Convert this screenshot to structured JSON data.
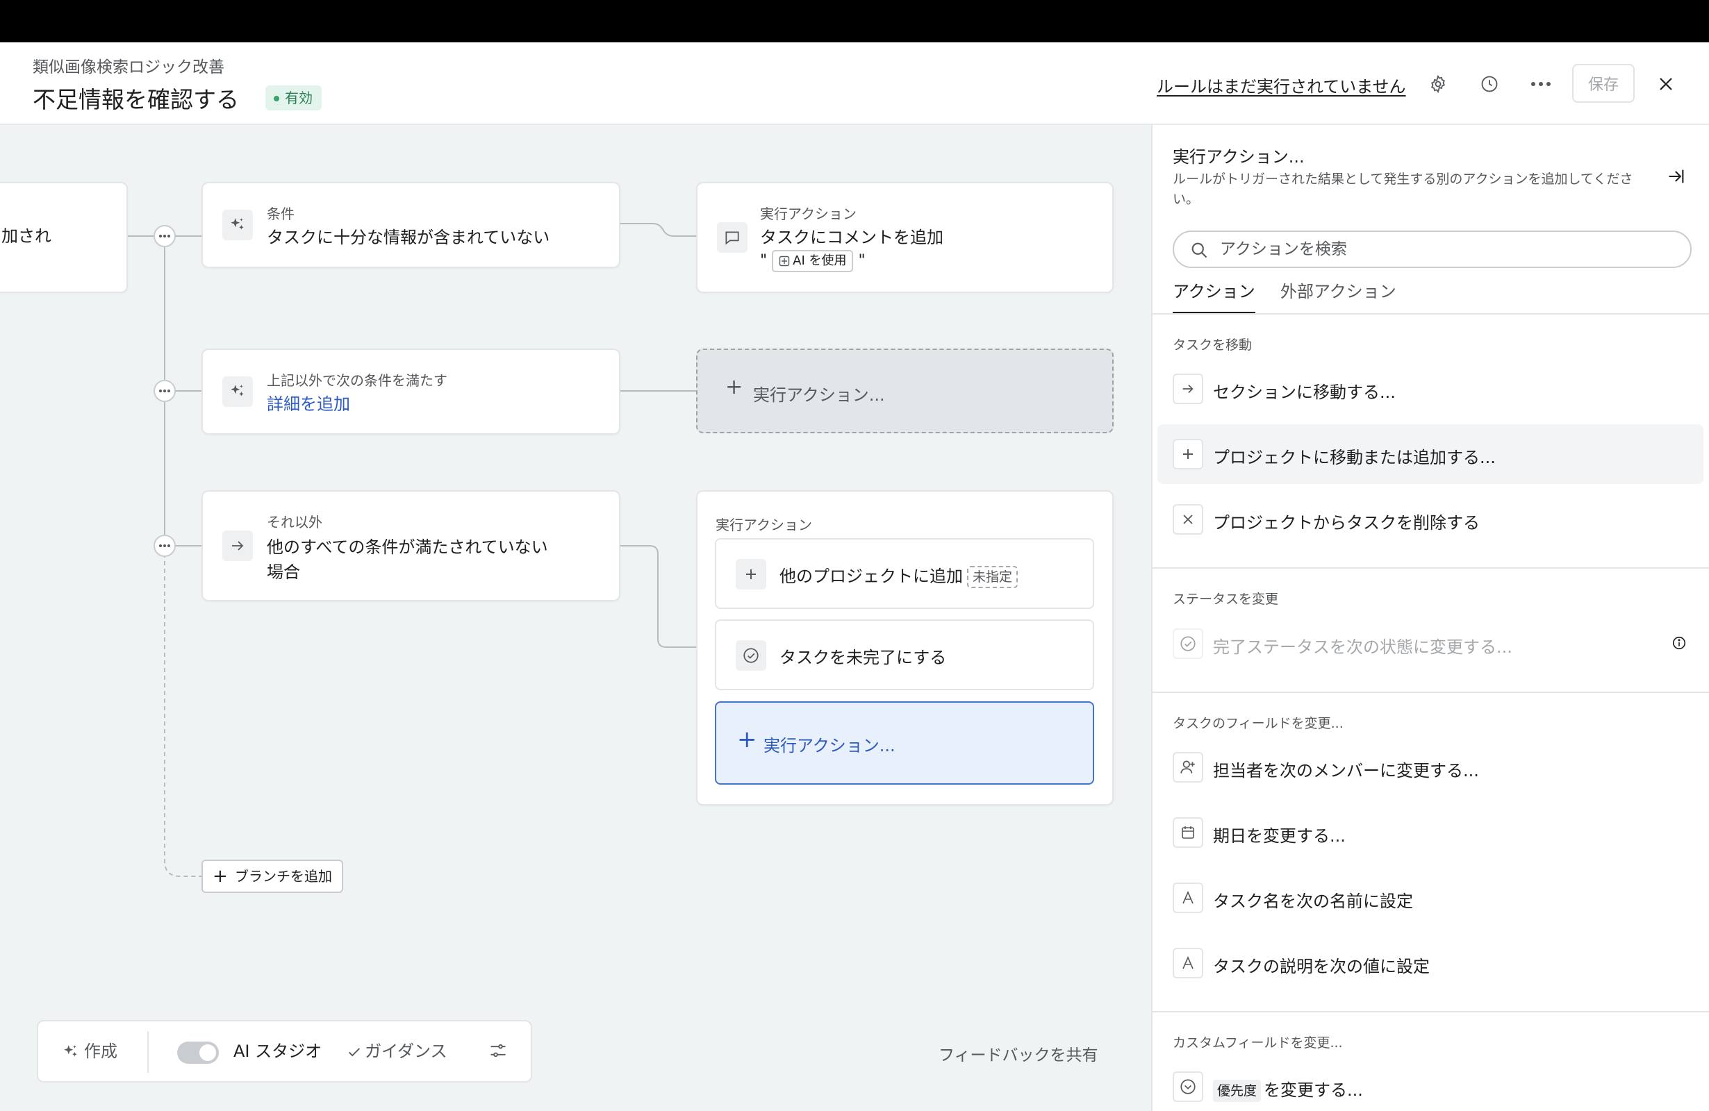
{
  "header": {
    "breadcrumb": "類似画像検索ロジック改善",
    "title": "不足情報を確認する",
    "status_badge": "有効",
    "run_status_link": "ルールはまだ実行されていません",
    "save_label": "保存"
  },
  "canvas": {
    "trigger_partial": "加され",
    "branch1": {
      "label": "条件",
      "text": "タスクに十分な情報が含まれていない"
    },
    "action1": {
      "label": "実行アクション",
      "text": "タスクにコメントを追加",
      "ai_quote_open": "\"",
      "ai_pill": "AI を使用",
      "ai_quote_close": "\""
    },
    "branch2": {
      "label": "上記以外で次の条件を満たす",
      "link": "詳細を追加"
    },
    "placeholder_action": "実行アクション...",
    "branch3": {
      "label": "それ以外",
      "text_line1": "他のすべての条件が満たされていない",
      "text_line2": "場合"
    },
    "action_group": {
      "label": "実行アクション",
      "items": [
        {
          "text": "他のプロジェクトに追加",
          "tag": "未指定"
        },
        {
          "text": "タスクを未完了にする"
        }
      ],
      "add_label": "実行アクション..."
    },
    "add_branch": "ブランチを追加"
  },
  "toolbar": {
    "create": "作成",
    "ai_studio": "AI スタジオ",
    "guidance": "ガイダンス",
    "feedback": "フィードバックを共有"
  },
  "panel": {
    "title": "実行アクション...",
    "description": "ルールがトリガーされた結果として発生する別のアクションを追加してください。",
    "search_placeholder": "アクションを検索",
    "tabs": [
      "アクション",
      "外部アクション"
    ],
    "sections": [
      {
        "title": "タスクを移動",
        "items": [
          "セクションに移動する...",
          "プロジェクトに移動または追加する...",
          "プロジェクトからタスクを削除する"
        ]
      },
      {
        "title": "ステータスを変更",
        "items": [
          "完了ステータスを次の状態に変更する..."
        ]
      },
      {
        "title": "タスクのフィールドを変更...",
        "items": [
          "担当者を次のメンバーに変更する...",
          "期日を変更する...",
          "タスク名を次の名前に設定",
          "タスクの説明を次の値に設定"
        ]
      },
      {
        "title": "カスタムフィールドを変更...",
        "items": [
          {
            "chip": "優先度",
            "text": "を変更する..."
          }
        ]
      }
    ]
  }
}
